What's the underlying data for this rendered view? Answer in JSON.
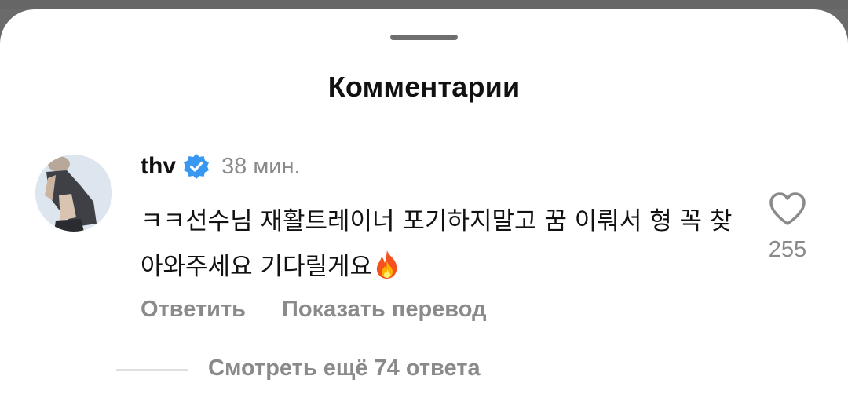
{
  "sheet": {
    "title": "Комментарии"
  },
  "comment": {
    "username": "thv",
    "verified": true,
    "timestamp": "38 мин.",
    "text": "ㅋㅋ선수님 재활트레이너 포기하지말고 꿈 이뤄서 형 꼭 찾아와주세요 기다릴게요",
    "emoji": "fire",
    "likes": "255",
    "reply_label": "Ответить",
    "translate_label": "Показать перевод",
    "view_replies_label": "Смотреть ещё 74 ответа"
  },
  "colors": {
    "verified_badge": "#3897f0",
    "muted_text": "#8a8a8a",
    "primary_text": "#111111",
    "backdrop": "#6b6b6b"
  },
  "icons": {
    "verified": "verified-check-icon",
    "like": "heart-outline-icon",
    "emoji": "fire-emoji-icon"
  }
}
